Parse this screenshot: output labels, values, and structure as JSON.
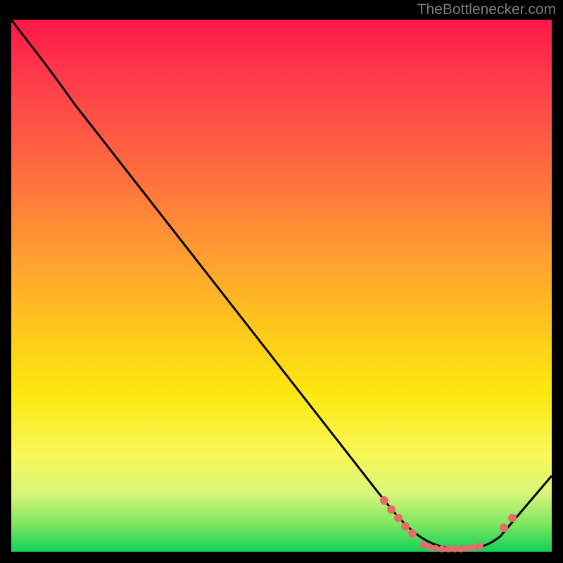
{
  "attribution": "TheBottlenecker.com",
  "chart_data": {
    "type": "line",
    "title": "",
    "xlabel": "",
    "ylabel": "",
    "xlim": [
      0,
      100
    ],
    "ylim": [
      0,
      100
    ],
    "series": [
      {
        "name": "bottleneck-curve",
        "x": [
          0,
          5,
          10,
          20,
          30,
          40,
          50,
          60,
          68,
          74,
          80,
          84,
          88,
          92,
          100
        ],
        "y": [
          100,
          93,
          86,
          72,
          58,
          44,
          31,
          18,
          10,
          5,
          1,
          0,
          1,
          5,
          14
        ]
      }
    ],
    "markers": {
      "name": "highlight-dots",
      "color": "#e86a6a",
      "x": [
        69,
        70,
        71,
        72.5,
        74,
        76,
        77,
        78.5,
        80,
        81,
        82.5,
        84,
        85,
        86,
        87,
        91,
        92.5
      ],
      "y": [
        9.5,
        8,
        6.5,
        5,
        3.5,
        2,
        1.5,
        1,
        0.5,
        0.5,
        0.5,
        0.5,
        0.7,
        1,
        1.3,
        4.5,
        6
      ]
    },
    "background_gradient": {
      "direction": "vertical",
      "stops": [
        {
          "pos": 0.0,
          "color": "#ff1748"
        },
        {
          "pos": 0.12,
          "color": "#ff3e4a"
        },
        {
          "pos": 0.28,
          "color": "#ff6b3f"
        },
        {
          "pos": 0.44,
          "color": "#ff9d30"
        },
        {
          "pos": 0.58,
          "color": "#ffc81c"
        },
        {
          "pos": 0.7,
          "color": "#fbe80d"
        },
        {
          "pos": 0.82,
          "color": "#f8f85a"
        },
        {
          "pos": 0.89,
          "color": "#d9f57a"
        },
        {
          "pos": 0.95,
          "color": "#79e65f"
        },
        {
          "pos": 1.0,
          "color": "#10d258"
        }
      ]
    },
    "frame_color": "#000000"
  }
}
